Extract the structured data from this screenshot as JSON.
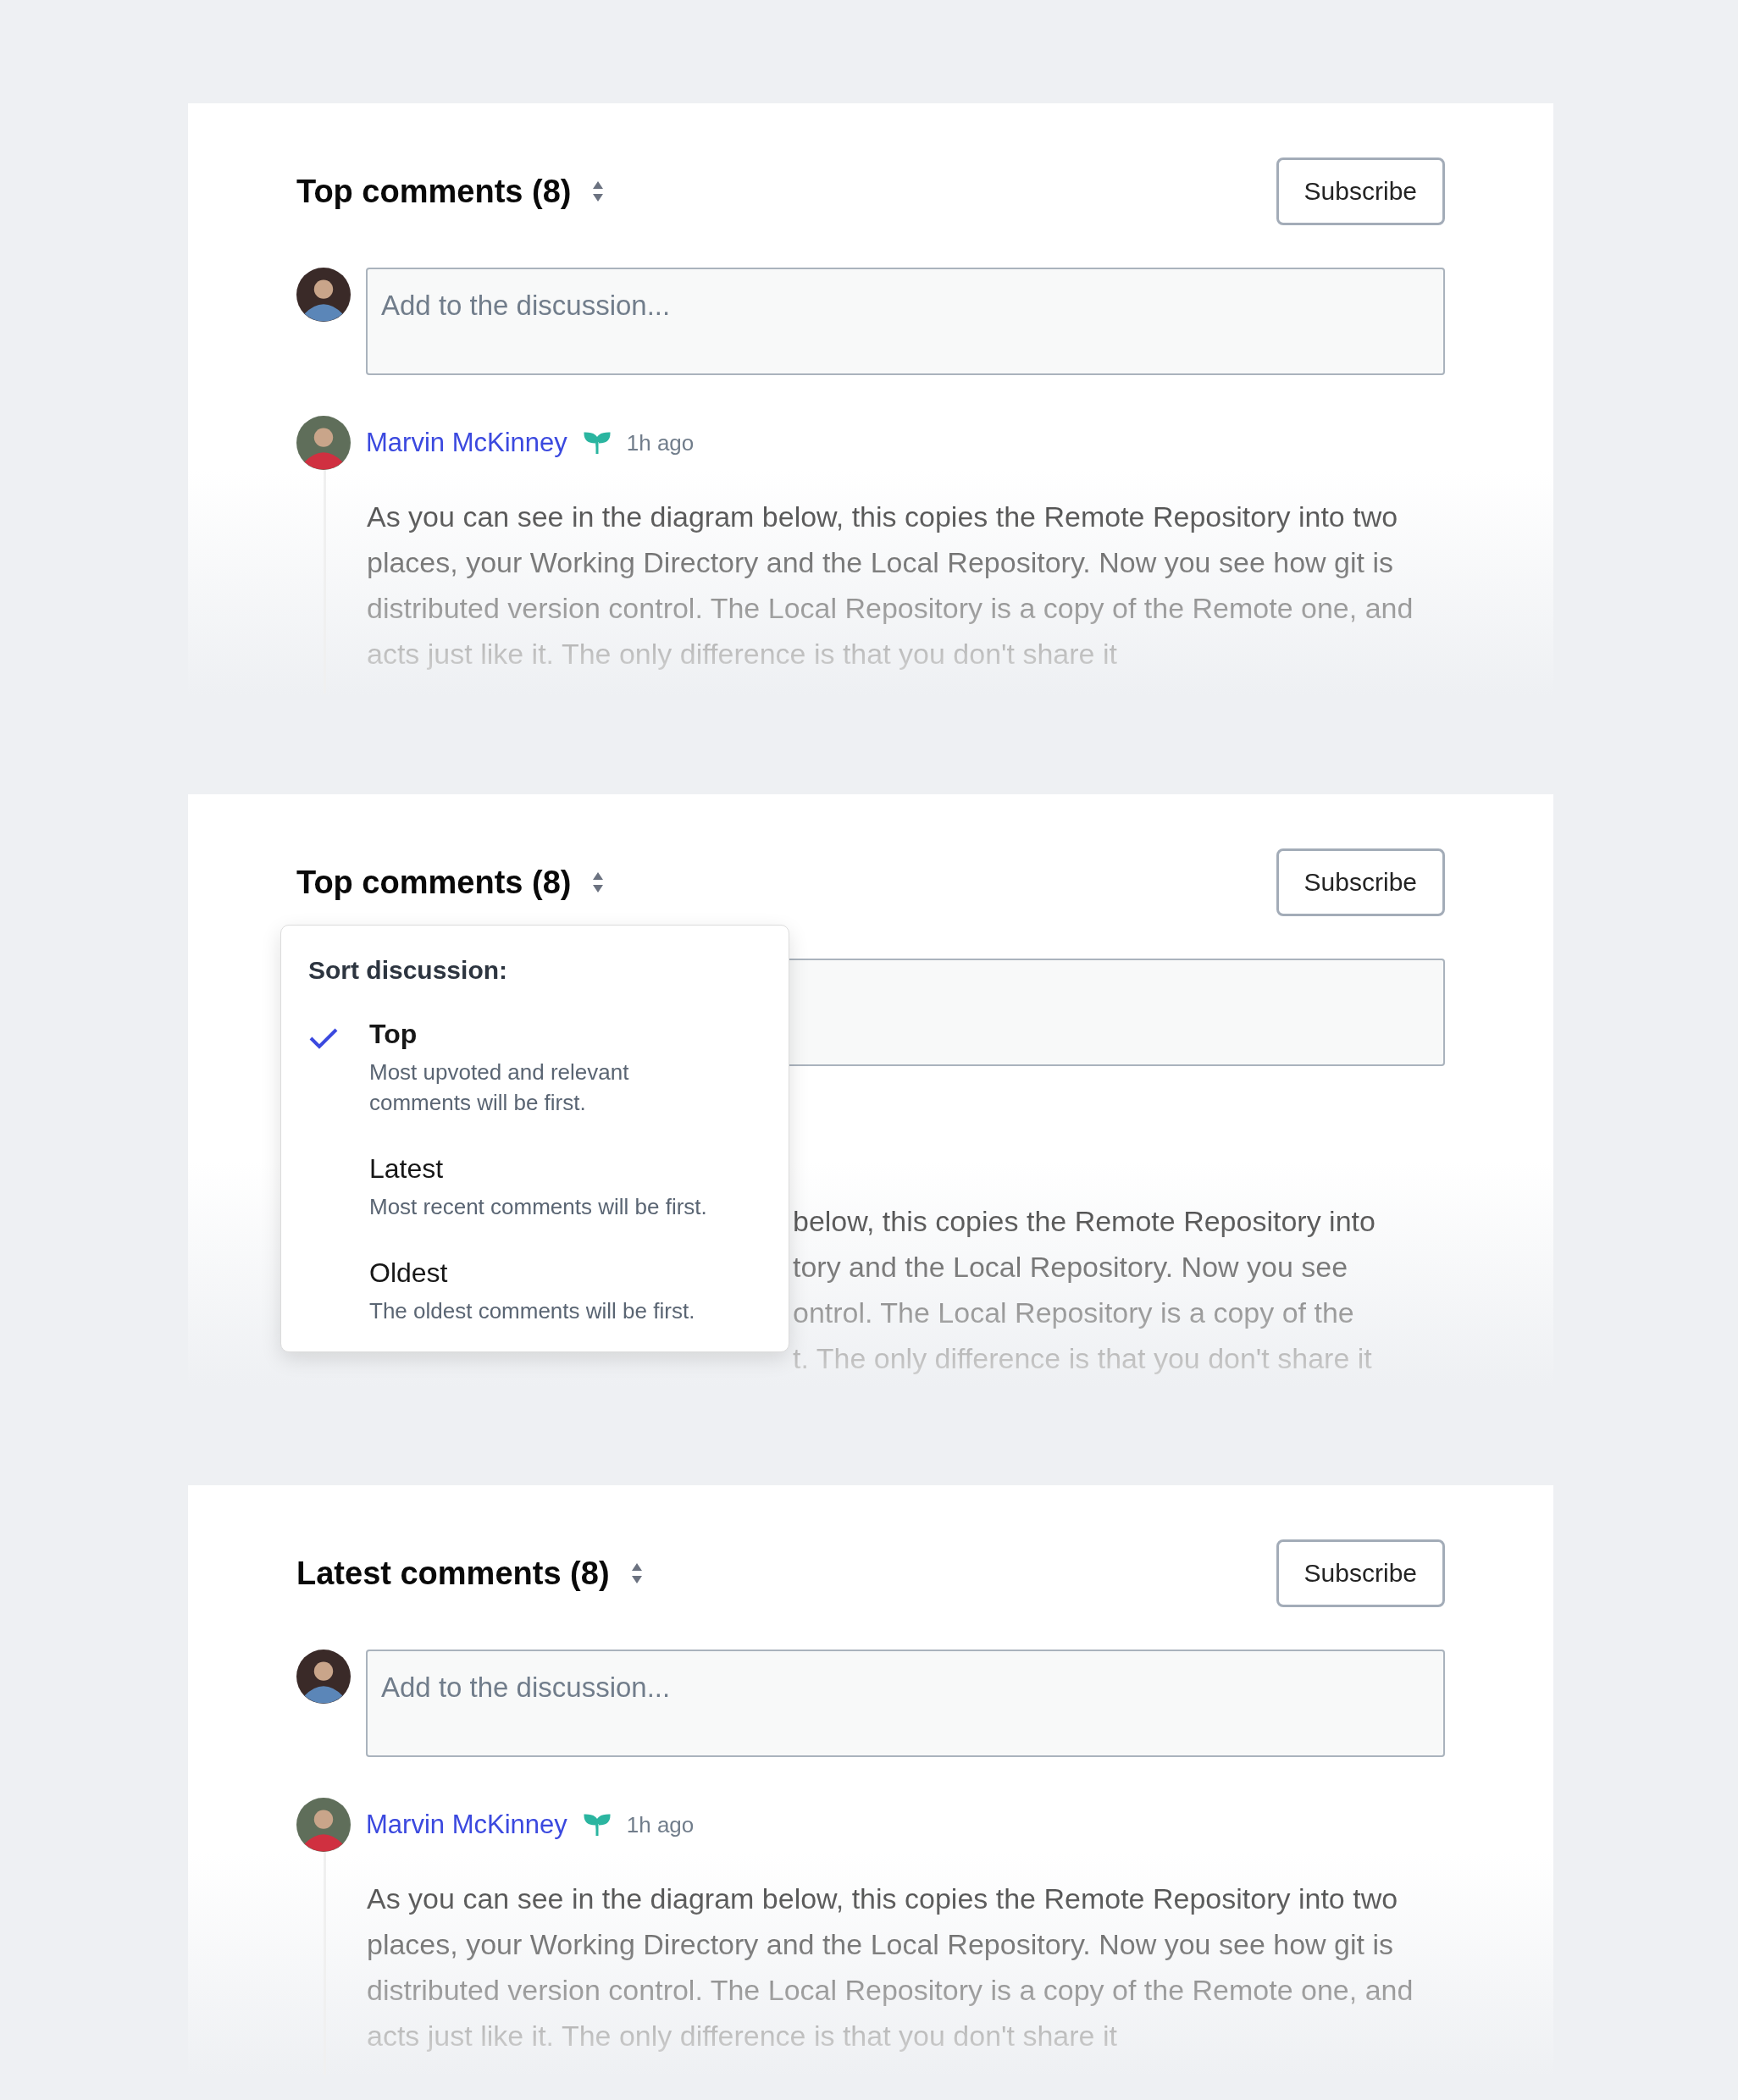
{
  "panels": [
    {
      "kind": "plain",
      "title": "Top comments (8)",
      "subscribe": "Subscribe",
      "composer": {
        "placeholder": "Add to the discussion..."
      },
      "comment": {
        "author": "Marvin McKinney",
        "time": "1h ago",
        "body": "As you can see in the diagram below, this copies the Remote Repository into two places, your Working Directory and the Local Repository. Now you see how git is distributed version control. The Local Repository is a copy of the Remote one, and acts just like it. The only difference is that you don't share it"
      }
    },
    {
      "kind": "menu-open",
      "title": "Top comments (8)",
      "subscribe": "Subscribe",
      "comment": {
        "fragments": [
          "below, this copies the Remote Repository into",
          "tory and the Local Repository. Now you see",
          "ontrol. The Local Repository is a copy of the",
          "t. The only difference is that you don't share it"
        ]
      },
      "sort_menu": {
        "heading": "Sort discussion:",
        "options": [
          {
            "label": "Top",
            "description": "Most upvoted and relevant comments will be first.",
            "selected": true
          },
          {
            "label": "Latest",
            "description": "Most recent comments will be first.",
            "selected": false
          },
          {
            "label": "Oldest",
            "description": "The oldest comments will be first.",
            "selected": false
          }
        ]
      }
    },
    {
      "kind": "plain",
      "title": "Latest comments (8)",
      "subscribe": "Subscribe",
      "composer": {
        "placeholder": "Add to the discussion..."
      },
      "comment": {
        "author": "Marvin McKinney",
        "time": "1h ago",
        "body": "As you can see in the diagram below, this copies the Remote Repository into two places, your Working Directory and the Local Repository. Now you see how git is distributed version control. The Local Repository is a copy of the Remote one, and acts just like it. The only difference is that you don't share it"
      }
    }
  ]
}
